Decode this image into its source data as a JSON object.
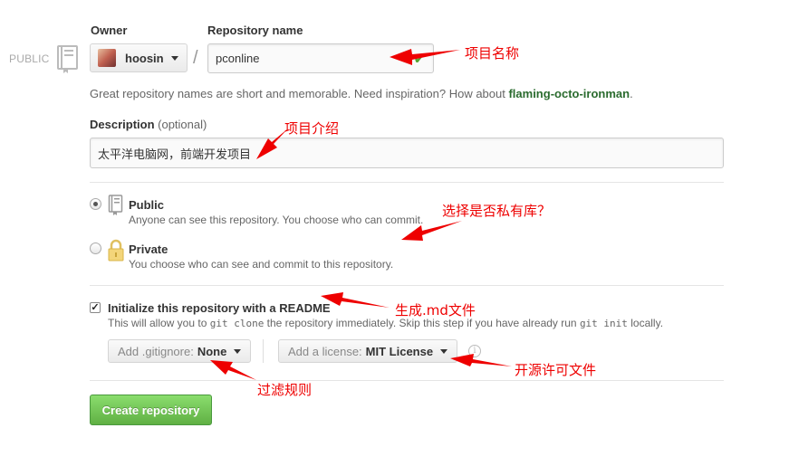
{
  "visibility_tag": "PUBLIC",
  "owner": {
    "label": "Owner",
    "value": "hoosin"
  },
  "repo_name": {
    "label": "Repository name",
    "value": "pconline"
  },
  "name_hint": {
    "prefix": "Great repository names are short and memorable. Need inspiration? How about ",
    "suggestion": "flaming-octo-ironman",
    "suffix": "."
  },
  "description": {
    "label": "Description",
    "optional": "(optional)",
    "value": "太平洋电脑网，前端开发项目"
  },
  "visibility": {
    "selected": "public",
    "options": [
      {
        "title": "Public",
        "desc": "Anyone can see this repository. You choose who can commit."
      },
      {
        "title": "Private",
        "desc": "You choose who can see and commit to this repository."
      }
    ]
  },
  "readme": {
    "checked": true,
    "label": "Initialize this repository with a README",
    "desc_1": "This will allow you to ",
    "code_1": "git clone",
    "desc_2": " the repository immediately. Skip this step if you have already run ",
    "code_2": "git init",
    "desc_3": " locally."
  },
  "gitignore": {
    "prefix": "Add .gitignore:",
    "value": "None"
  },
  "license": {
    "prefix": "Add a license:",
    "value": "MIT License"
  },
  "create_button": "Create repository",
  "annotations": {
    "name": "项目名称",
    "desc": "项目介绍",
    "visibility": "选择是否私有库？",
    "readme": "生成.md文件",
    "gitignore": "过滤规则",
    "license": "开源许可文件"
  },
  "colors": {
    "annotation": "#ee0000",
    "create_button": "#60b044",
    "suggestion": "#2a6b2e"
  }
}
